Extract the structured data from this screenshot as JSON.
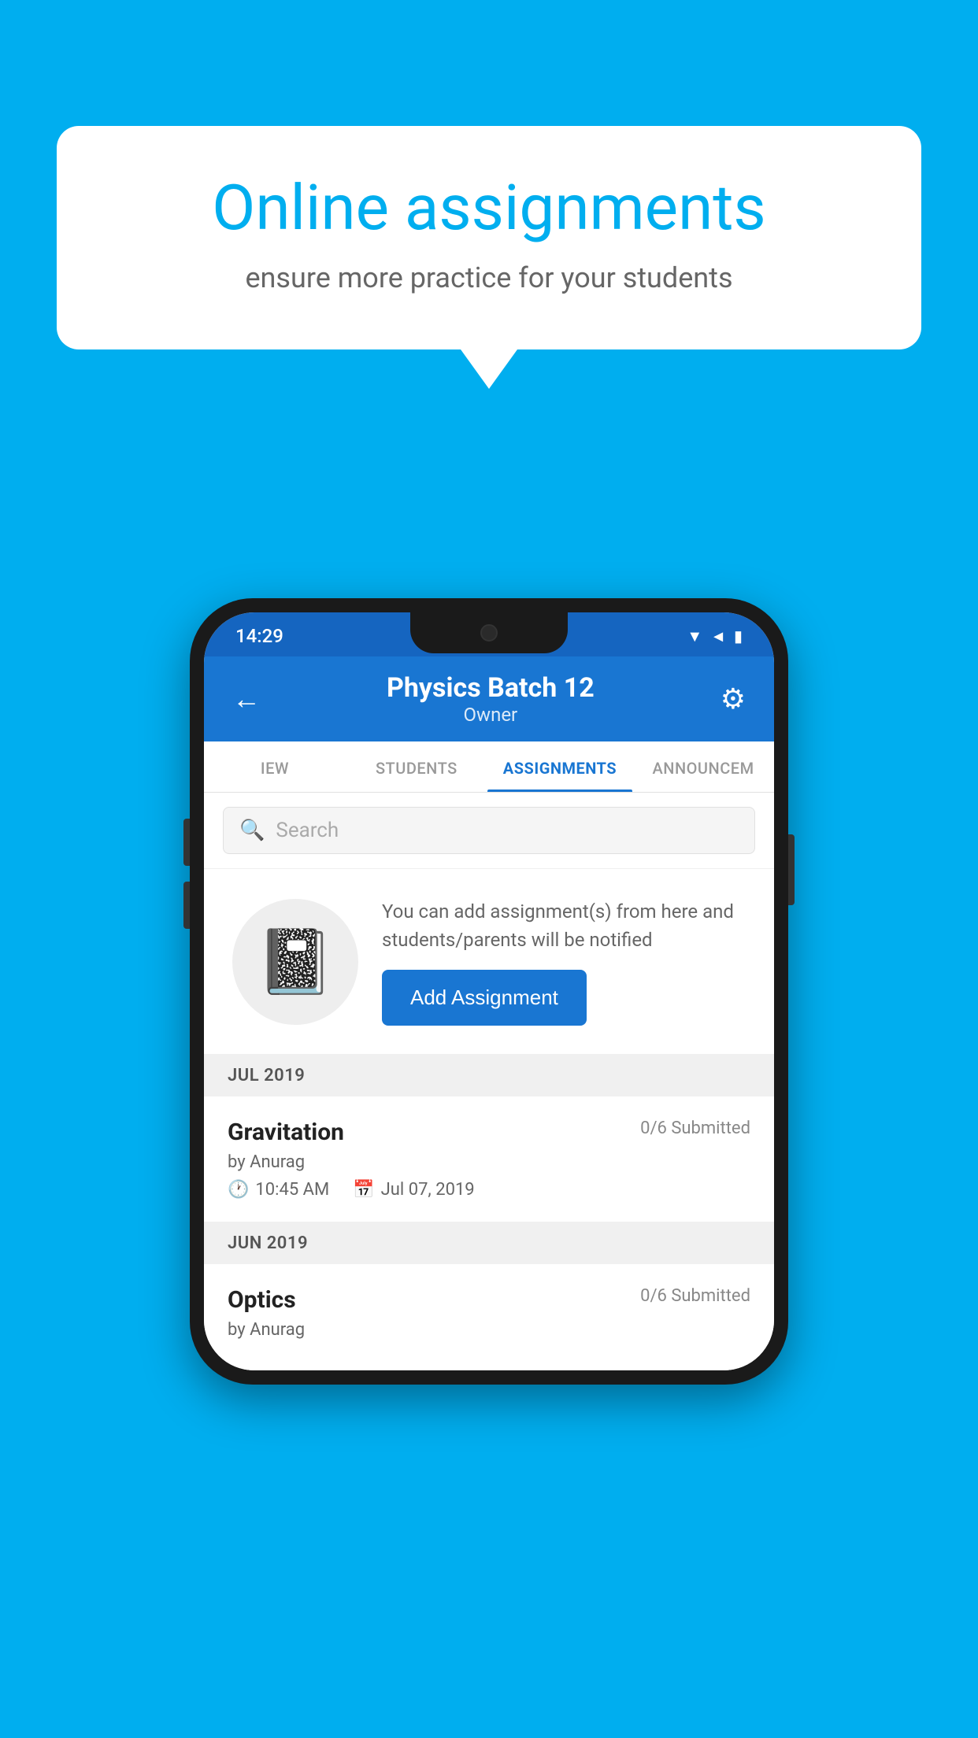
{
  "background_color": "#00AEEF",
  "speech_bubble": {
    "title": "Online assignments",
    "subtitle": "ensure more practice for your students"
  },
  "status_bar": {
    "time": "14:29",
    "wifi_icon": "▼",
    "signal_icon": "◄",
    "battery_icon": "▮"
  },
  "header": {
    "title": "Physics Batch 12",
    "subtitle": "Owner",
    "back_icon": "←",
    "settings_icon": "⚙"
  },
  "tabs": [
    {
      "label": "IEW",
      "active": false
    },
    {
      "label": "STUDENTS",
      "active": false
    },
    {
      "label": "ASSIGNMENTS",
      "active": true
    },
    {
      "label": "ANNOUNCEM",
      "active": false
    }
  ],
  "search": {
    "placeholder": "Search"
  },
  "promo": {
    "text": "You can add assignment(s) from here and students/parents will be notified",
    "button_label": "Add Assignment"
  },
  "sections": [
    {
      "month": "JUL 2019",
      "assignments": [
        {
          "title": "Gravitation",
          "submitted": "0/6 Submitted",
          "author": "by Anurag",
          "time": "10:45 AM",
          "date": "Jul 07, 2019"
        }
      ]
    },
    {
      "month": "JUN 2019",
      "assignments": [
        {
          "title": "Optics",
          "submitted": "0/6 Submitted",
          "author": "by Anurag",
          "time": "",
          "date": ""
        }
      ]
    }
  ]
}
